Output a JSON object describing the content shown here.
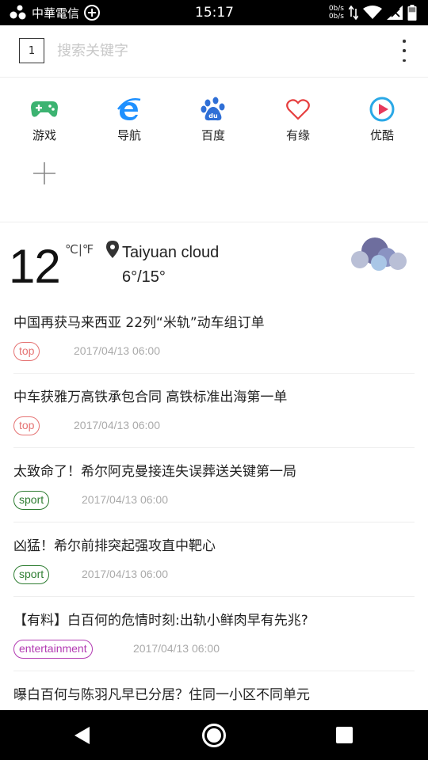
{
  "status_bar": {
    "carrier": "中華電信",
    "time": "15:17",
    "net_up": "0b/s",
    "net_down": "0b/s"
  },
  "header": {
    "tab_count": "1",
    "search_placeholder": "搜索关键字"
  },
  "quick_links": [
    {
      "label": "游戏",
      "icon": "gamepad-icon",
      "color": "#3cb371"
    },
    {
      "label": "导航",
      "icon": "ie-icon",
      "color": "#1e90ff"
    },
    {
      "label": "百度",
      "icon": "baidu-paw-icon",
      "color": "#2f6fd6"
    },
    {
      "label": "有缘",
      "icon": "heart-icon",
      "color": "#e64040"
    },
    {
      "label": "优酷",
      "icon": "youku-play-icon",
      "color": "#2aa8e6"
    }
  ],
  "weather": {
    "temperature": "12",
    "unit": "℃|℉",
    "city": "Taiyuan cloud",
    "range": "6°/15°"
  },
  "news": [
    {
      "title": "中国再获马来西亚 22列“米轨”动车组订单",
      "tag": "top",
      "tag_color": "#e57373",
      "date": "2017/04/13 06:00"
    },
    {
      "title": "中车获雅万高铁承包合同 高铁标准出海第一单",
      "tag": "top",
      "tag_color": "#e57373",
      "date": "2017/04/13 06:00"
    },
    {
      "title": "太致命了！希尔阿克曼接连失误葬送关键第一局",
      "tag": "sport",
      "tag_color": "#2e7d32",
      "date": "2017/04/13 06:00"
    },
    {
      "title": "凶猛！希尔前排突起强攻直中靶心",
      "tag": "sport",
      "tag_color": "#2e7d32",
      "date": "2017/04/13 06:00"
    },
    {
      "title": "【有料】白百何的危情时刻:出轨小鲜肉早有先兆?",
      "tag": "entertainment",
      "tag_color": "#b23ab2",
      "date": "2017/04/13 06:00"
    },
    {
      "title": "曝白百何与陈羽凡早已分居？住同一小区不同单元",
      "tag": "",
      "tag_color": "#b23ab2",
      "date": ""
    }
  ]
}
